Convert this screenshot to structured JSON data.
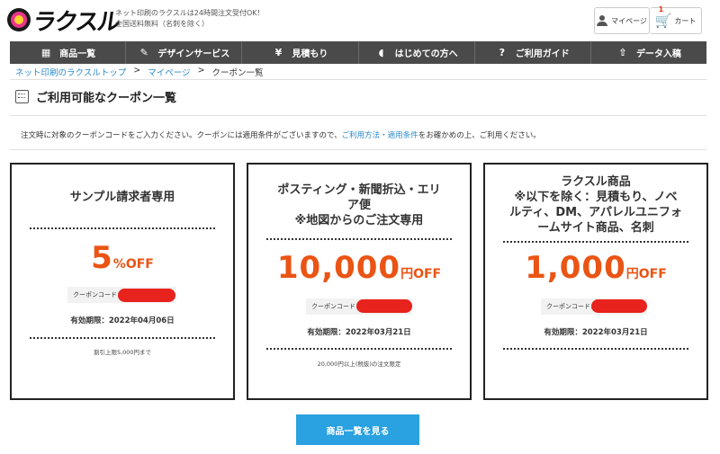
{
  "header": {
    "logo_text": "ラクスル",
    "tagline_line1": "ネット印刷のラクスルは24時間注文受付OK！",
    "tagline_line2": "全国送料無料（名刺を除く）",
    "mypage_label": "マイページ",
    "cart_label": "カート",
    "cart_count": "1"
  },
  "nav": {
    "items": [
      {
        "label": "商品一覧",
        "icon": "grid-icon"
      },
      {
        "label": "デザインサービス",
        "icon": "pencil-icon"
      },
      {
        "label": "見積もり",
        "icon": "yen-icon"
      },
      {
        "label": "はじめての方へ",
        "icon": "beginner-mark-icon"
      },
      {
        "label": "ご利用ガイド",
        "icon": "question-icon"
      },
      {
        "label": "データ入稿",
        "icon": "upload-icon"
      }
    ]
  },
  "breadcrumb": {
    "items": [
      "ネット印刷のラクスルトップ",
      "マイページ",
      "クーポン一覧"
    ],
    "separator": ">"
  },
  "page": {
    "title": "ご利用可能なクーポン一覧",
    "notice_before": "注文時に対象のクーポンコードをご入力ください。クーポンには適用条件がございますので、",
    "notice_link": "ご利用方法・適用条件",
    "notice_after": "をお確かめの上、ご利用ください。"
  },
  "coupons": [
    {
      "title_lines": [
        "サンプル請求者専用"
      ],
      "amount": "5",
      "unit": "%OFF",
      "code_label": "クーポンコード：",
      "expiry": "有効期限：2022年04月06日",
      "condition": "割引上限5,000円まで"
    },
    {
      "title_lines": [
        "ポスティング・新聞折込・エリ",
        "ア便",
        "※地図からのご注文専用"
      ],
      "amount": "10,000",
      "unit": "円OFF",
      "code_label": "クーポンコード：",
      "expiry": "有効期限：2022年03月21日",
      "condition": "20,000円以上(税抜)の注文限定"
    },
    {
      "title_lines": [
        "ラクスル商品",
        "※以下を除く：見積もり、ノベ",
        "ルティ、DM、アパレルユニフォ",
        "ームサイト商品、名刺"
      ],
      "amount": "1,000",
      "unit": "円OFF",
      "code_label": "クーポンコード：",
      "expiry": "有効期限：2022年03月21日",
      "condition": ""
    }
  ],
  "cta": {
    "label": "商品一覧を見る"
  },
  "colors": {
    "accent": "#ea5414",
    "link": "#2b8bc9",
    "nav_bg": "#4a4a4a",
    "cta_bg": "#2aa1e0",
    "redaction": "#e8221c"
  }
}
